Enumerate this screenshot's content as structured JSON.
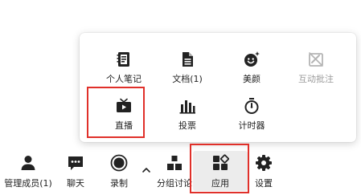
{
  "apps_popup": {
    "items": [
      {
        "label": "个人笔记",
        "icon": "notebook-icon",
        "enabled": true
      },
      {
        "label": "文档(1)",
        "icon": "document-icon",
        "enabled": true
      },
      {
        "label": "美颜",
        "icon": "beauty-face-icon",
        "enabled": true
      },
      {
        "label": "互动批注",
        "icon": "annotation-icon",
        "enabled": false
      },
      {
        "label": "直播",
        "icon": "live-tv-icon",
        "enabled": true,
        "highlighted": true
      },
      {
        "label": "投票",
        "icon": "bar-chart-icon",
        "enabled": true
      },
      {
        "label": "计时器",
        "icon": "stopwatch-icon",
        "enabled": true
      }
    ]
  },
  "toolbar": {
    "items": [
      {
        "label": "管理成员(1)",
        "icon": "members-icon"
      },
      {
        "label": "聊天",
        "icon": "chat-icon"
      },
      {
        "label": "录制",
        "icon": "record-icon"
      },
      {
        "label": "",
        "icon": "chevron-up-icon"
      },
      {
        "label": "分组讨论",
        "icon": "breakout-icon"
      },
      {
        "label": "应用",
        "icon": "apps-icon",
        "active": true,
        "highlighted": true
      },
      {
        "label": "设置",
        "icon": "gear-icon"
      }
    ]
  },
  "colors": {
    "highlight": "#e0302a",
    "icon": "#222222",
    "disabled_icon": "#b4b4b4",
    "active_bg": "#ececec"
  }
}
